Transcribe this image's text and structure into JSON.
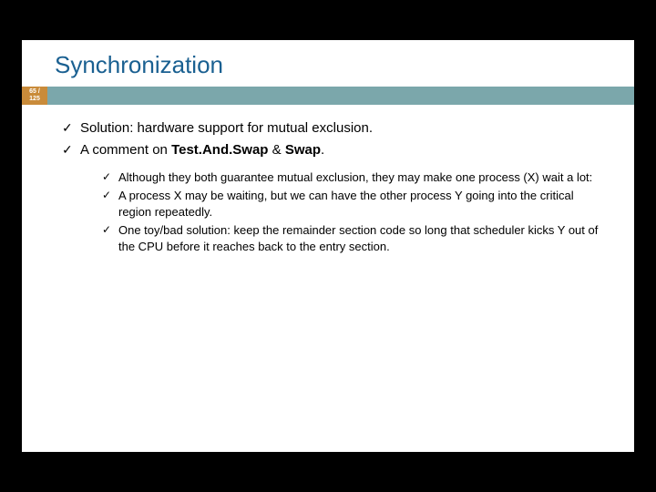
{
  "slide": {
    "title": "Synchronization",
    "page": {
      "num": "65 /",
      "den": "125"
    },
    "bullets": {
      "b1": {
        "text": "Solution: hardware support for mutual exclusion."
      },
      "b2": {
        "pre": "A comment on ",
        "strong1": "Test.And.Swap",
        "amp": " & ",
        "strong2": "Swap",
        "post": "."
      },
      "sub": {
        "s1": "Although they both guarantee mutual exclusion, they may make one process (X) wait a lot:",
        "s2": "A process X may be waiting, but we can have the other process Y going into the critical region repeatedly.",
        "s3": "One toy/bad solution: keep the remainder section code so long that scheduler kicks Y out of the CPU before it reaches back to the entry section."
      }
    }
  }
}
